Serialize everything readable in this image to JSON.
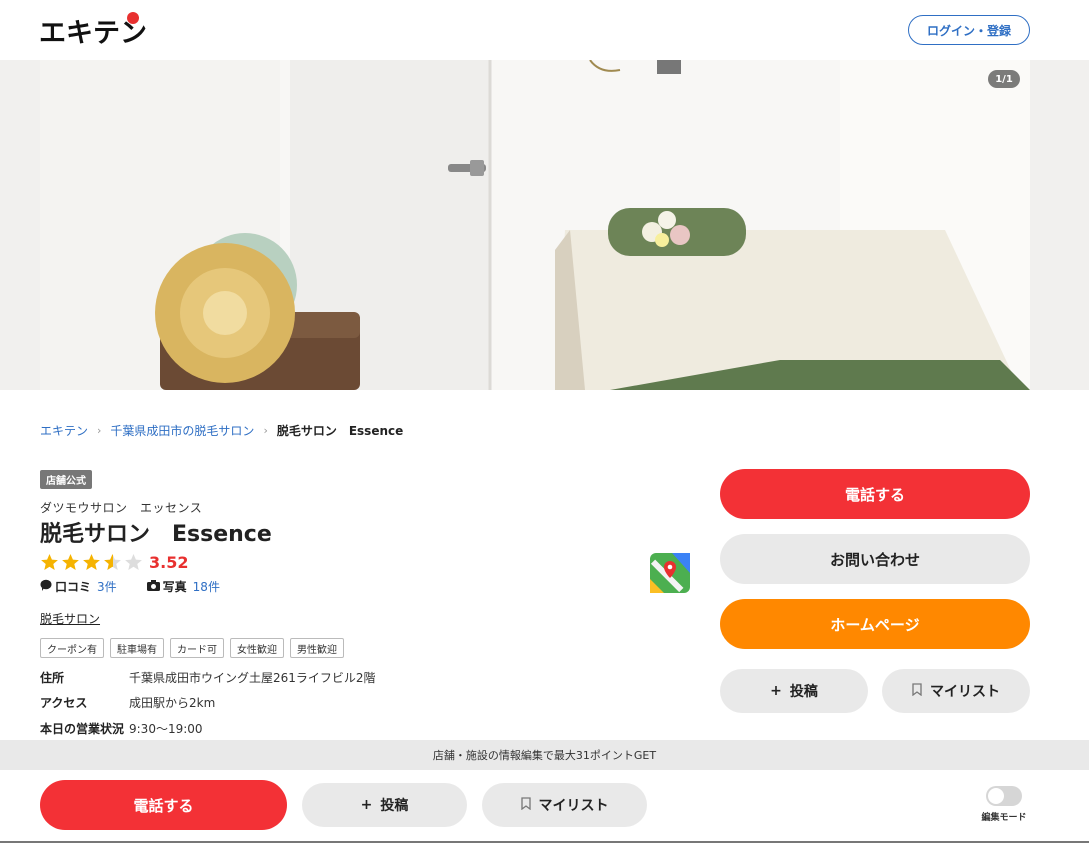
{
  "header": {
    "logo_text": "エキテン",
    "login_label": "ログイン・登録"
  },
  "hero": {
    "counter": "1/1"
  },
  "breadcrumb": {
    "items": [
      "エキテン",
      "千葉県成田市の脱毛サロン"
    ],
    "current": "脱毛サロン　Essence"
  },
  "shop": {
    "badge": "店舗公式",
    "kana": "ダツモウサロン　エッセンス",
    "name": "脱毛サロン　Essence",
    "rating": 3.52,
    "rating_text": "3.52",
    "rating_stars_max": 5,
    "reviews_label": "口コミ",
    "reviews_count": "3件",
    "photos_label": "写真",
    "photos_count": "18件",
    "genre": "脱毛サロン",
    "tags": [
      "クーポン有",
      "駐車場有",
      "カード可",
      "女性歓迎",
      "男性歓迎"
    ],
    "info": [
      {
        "label": "住所",
        "value": "千葉県成田市ウイング土屋261ライフビル2階"
      },
      {
        "label": "アクセス",
        "value": "成田駅から2km"
      },
      {
        "label": "本日の営業状況",
        "value": "9:30〜19:00"
      }
    ]
  },
  "actions": {
    "call": "電話する",
    "inquiry": "お問い合わせ",
    "homepage": "ホームページ",
    "post": "投稿",
    "mylist": "マイリスト"
  },
  "bottom": {
    "notice": "店舗・施設の情報編集で最大31ポイントGET",
    "call": "電話する",
    "post": "投稿",
    "mylist": "マイリスト",
    "edit_mode": "編集モード"
  },
  "colors": {
    "accent_blue": "#2f6fc4",
    "call_red": "#f33136",
    "homepage_orange": "#ff8800",
    "rating_red": "#e8302f",
    "star_gold": "#f5b301"
  },
  "icons": [
    "logo-icon",
    "chevron-right-icon",
    "star-icon",
    "speech-bubble-icon",
    "camera-icon",
    "map-pin-icon",
    "plus-icon",
    "bookmark-icon"
  ]
}
